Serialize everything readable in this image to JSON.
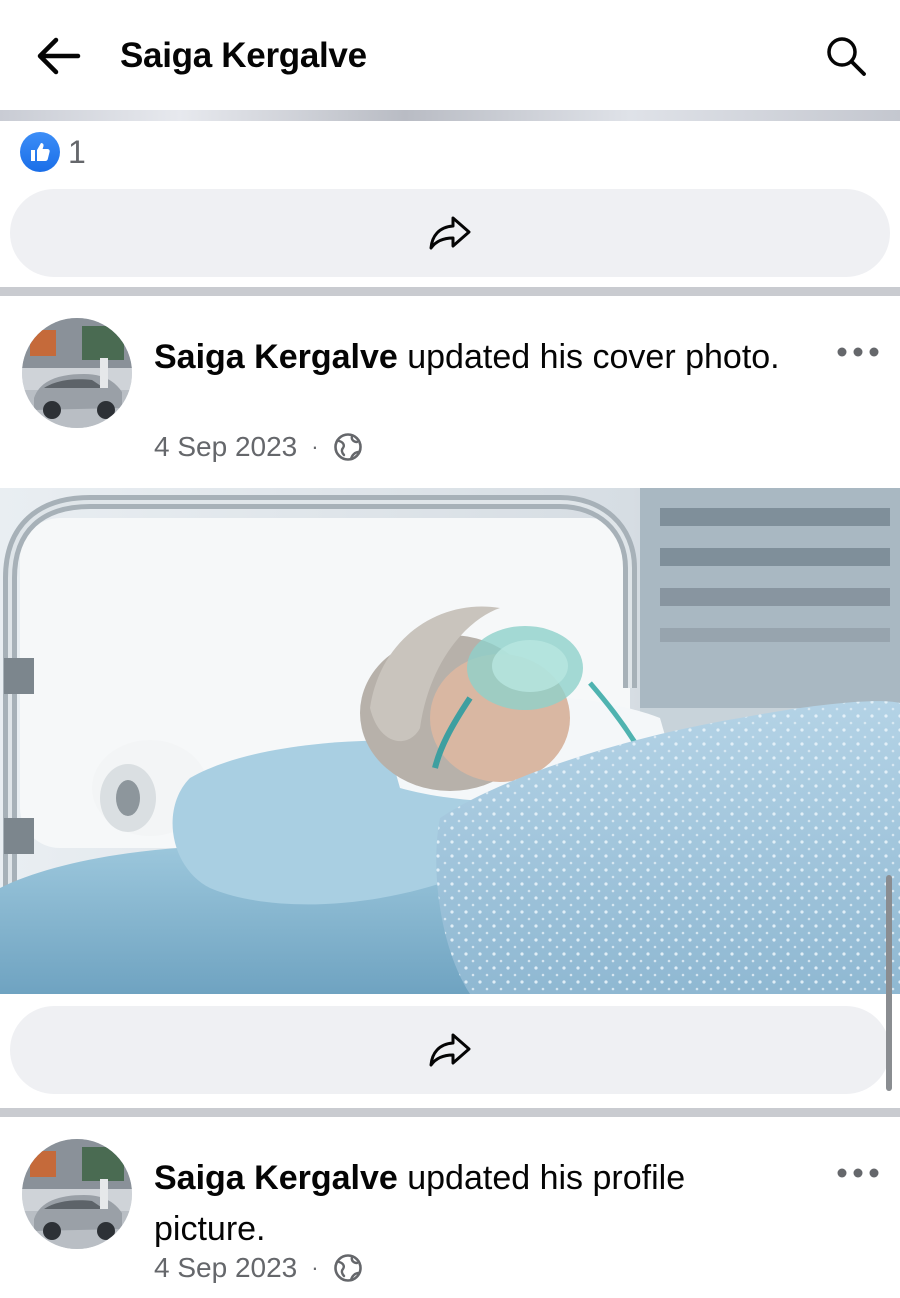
{
  "header": {
    "title": "Saiga Kergalve",
    "back_icon": "arrow-left-icon",
    "search_icon": "search-icon"
  },
  "previous_post": {
    "reaction_icon": "like-icon",
    "reaction_count": "1",
    "share_icon": "share-icon"
  },
  "posts": [
    {
      "author": "Saiga Kergalve",
      "action": " updated his cover photo.",
      "date": "4 Sep 2023",
      "separator": "·",
      "audience_icon": "globe-icon",
      "more_icon": "more-dots-icon",
      "share_icon": "share-icon"
    },
    {
      "author": "Saiga Kergalve",
      "action": " updated his profile picture.",
      "date": "4 Sep 2023",
      "separator": "·",
      "audience_icon": "globe-icon",
      "more_icon": "more-dots-icon"
    }
  ],
  "colors": {
    "like_blue": "#1a6ee8",
    "secondary_text": "#65676b",
    "pill_bg": "#eff0f3",
    "divider": "#c9cbd0"
  }
}
